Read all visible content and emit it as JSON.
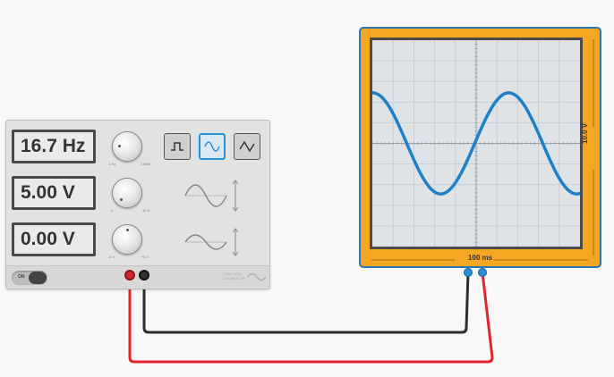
{
  "function_generator": {
    "frequency_display": "16.7 Hz",
    "amplitude_display": "5.00 V",
    "offset_display": "0.00 V",
    "frequency_knob": {
      "min_label": "1 Hz",
      "max_label": "1 MHz"
    },
    "amplitude_knob": {
      "min_label": "0",
      "max_label": "10 V"
    },
    "offset_knob": {
      "min_label": "-5 V",
      "max_label": "+5 V"
    },
    "waveforms": [
      "square",
      "sine",
      "triangle"
    ],
    "selected_waveform": "sine",
    "power_label": "ON",
    "brand_label": "FUNCTION GENERATOR",
    "colors": {
      "panel": "#e2e2e2",
      "active": "#2a8fd6"
    }
  },
  "oscilloscope": {
    "time_label": "100 ms",
    "voltage_label": "10.0 V",
    "colors": {
      "frame": "#f5a623",
      "border": "#2b78b4",
      "trace": "#1f7fc7"
    }
  },
  "wires": {
    "positive_color": "#e0242b",
    "ground_color": "#2d2d2d"
  }
}
